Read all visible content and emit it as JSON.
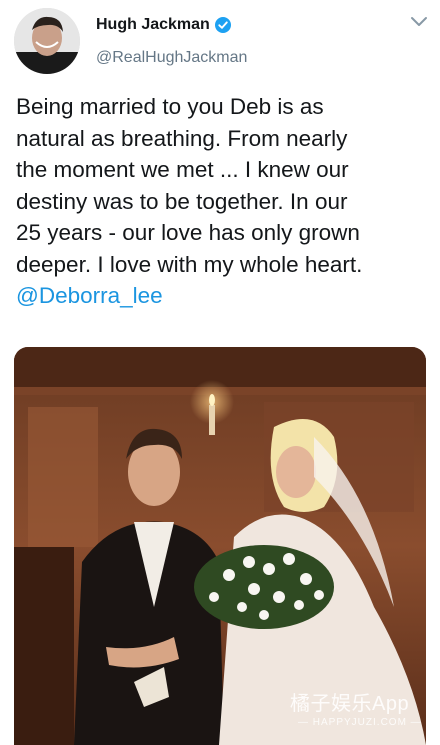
{
  "header": {
    "display_name": "Hugh Jackman",
    "handle": "@RealHughJackman",
    "verified": true
  },
  "tweet": {
    "lines": [
      "Being married to you Deb is as",
      "natural as breathing. From nearly",
      "the moment we met ... I knew our",
      "destiny was to be together. In our",
      "25 years - our love has only grown",
      "deeper. I love with my whole heart."
    ],
    "mention": "@Deborra_lee"
  },
  "watermark": {
    "title": "橘子娱乐App",
    "subtitle": "— HAPPYJUZI.COM —"
  },
  "icons": {
    "verified": "verified-badge-icon",
    "menu": "chevron-down-icon"
  },
  "colors": {
    "link": "#1b95e0",
    "verified": "#1da1f2",
    "text": "#14171a",
    "secondary": "#657786"
  }
}
